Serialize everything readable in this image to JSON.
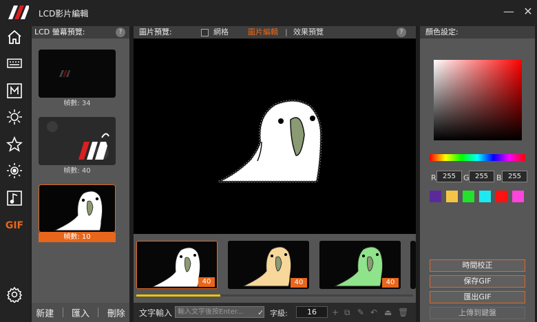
{
  "app": {
    "title": "LCD影片編輯"
  },
  "window": {
    "minimize": "—",
    "close": "✕"
  },
  "nav": {
    "items": [
      {
        "icon": "home-icon"
      },
      {
        "icon": "keyboard-icon"
      },
      {
        "icon": "macro-icon",
        "text": "M"
      },
      {
        "icon": "brightness-icon"
      },
      {
        "icon": "star-icon"
      },
      {
        "icon": "lighting-icon"
      },
      {
        "icon": "music-icon"
      },
      {
        "icon": "gif-icon",
        "text": "GIF"
      },
      {
        "icon": "settings-icon"
      }
    ]
  },
  "lcd_panel": {
    "title": "LCD 螢幕預覽:",
    "help": "?",
    "items": [
      {
        "caption": "幀數: 34"
      },
      {
        "caption": "幀數: 40"
      },
      {
        "caption": "幀數: 10",
        "active": true
      }
    ],
    "actions": {
      "new": "新建",
      "import": "匯入",
      "delete": "刪除"
    }
  },
  "preview_panel": {
    "title": "圖片預覽:",
    "grid_label": "網格",
    "tab_edit": "圖片編輯",
    "separator": "|",
    "tab_effect": "效果預覽",
    "help": "?",
    "frames": [
      {
        "badge": "40",
        "active": true
      },
      {
        "badge": "40"
      },
      {
        "badge": "40"
      }
    ],
    "text_input_label": "文字輸入",
    "text_placeholder": "輸入文字後按Enter...",
    "confirm": "✓",
    "font_size_label": "字級:",
    "font_size_value": "16",
    "tools": [
      "+",
      "⧉",
      "✎",
      "↶",
      "⏏",
      "🗑"
    ]
  },
  "color_panel": {
    "title": "顏色設定:",
    "r_label": "R",
    "r_value": "255",
    "g_label": "G",
    "g_value": "255",
    "b_label": "B",
    "b_value": "255",
    "swatches": [
      "#5b2a9a",
      "#f4c447",
      "#22e22a",
      "#1de9f0",
      "#ff1111",
      "#ff44dd"
    ],
    "buttons": {
      "time_correct": "時間校正",
      "save_gif": "保存GIF",
      "export_gif": "匯出GIF",
      "upload": "上傳到鍵盤"
    }
  },
  "colors": {
    "accent": "#e8661b",
    "scroll_thumb": "#f0c300"
  }
}
